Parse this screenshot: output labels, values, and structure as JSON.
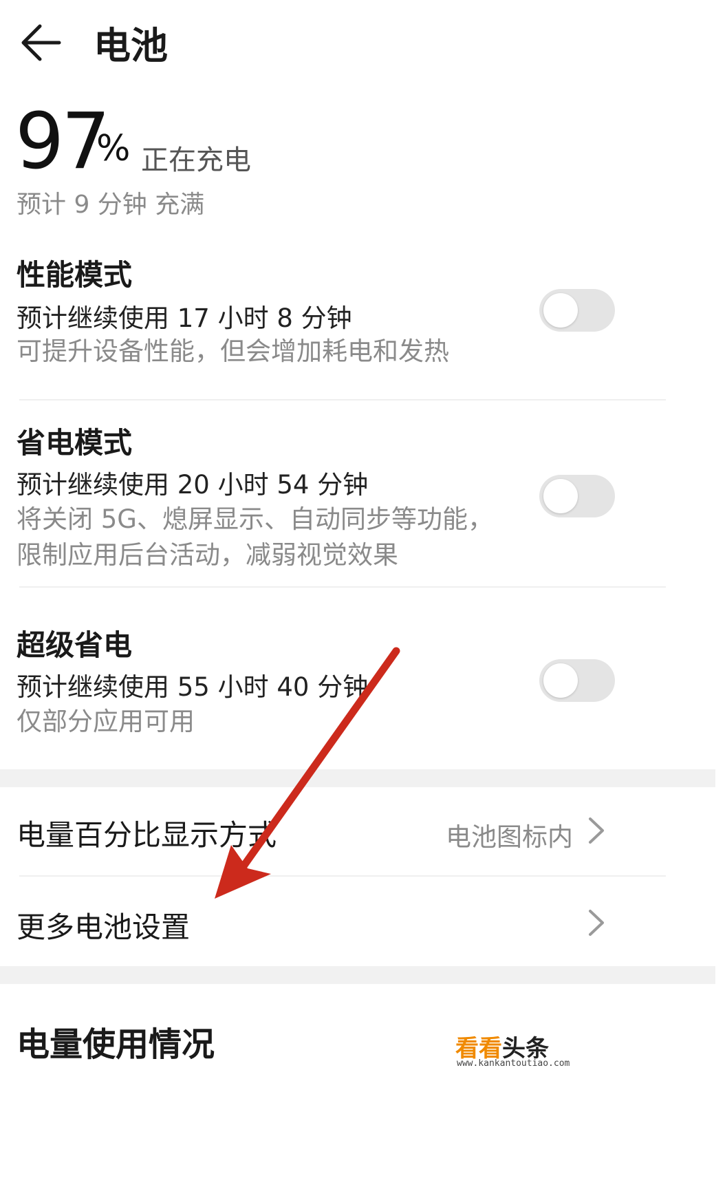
{
  "header": {
    "title": "电池"
  },
  "battery": {
    "percent": "97",
    "percent_sign": "%",
    "status": "正在充电",
    "estimate": "预计 9 分钟 充满"
  },
  "modes": [
    {
      "title": "性能模式",
      "usage": "预计继续使用 17 小时 8 分钟",
      "desc_lines": [
        "可提升设备性能，但会增加耗电和发热"
      ],
      "enabled": false
    },
    {
      "title": "省电模式",
      "usage": "预计继续使用 20 小时 54 分钟",
      "desc_lines": [
        "将关闭 5G、熄屏显示、自动同步等功能，",
        "限制应用后台活动，减弱视觉效果"
      ],
      "enabled": false
    },
    {
      "title": "超级省电",
      "usage": "预计继续使用 55 小时 40 分钟",
      "desc_lines": [
        "仅部分应用可用"
      ],
      "enabled": false
    }
  ],
  "settings": [
    {
      "label": "电量百分比显示方式",
      "value": "电池图标内"
    },
    {
      "label": "更多电池设置",
      "value": ""
    }
  ],
  "usage_section": {
    "title": "电量使用情况"
  },
  "watermark": {
    "brand_a": "看看",
    "brand_b": "头条",
    "url": "www.kankantoutiao.com"
  },
  "colors": {
    "annotation_arrow": "#cc2a1c",
    "toggle_off": "#e4e4e4",
    "watermark_orange": "#f08a00"
  }
}
